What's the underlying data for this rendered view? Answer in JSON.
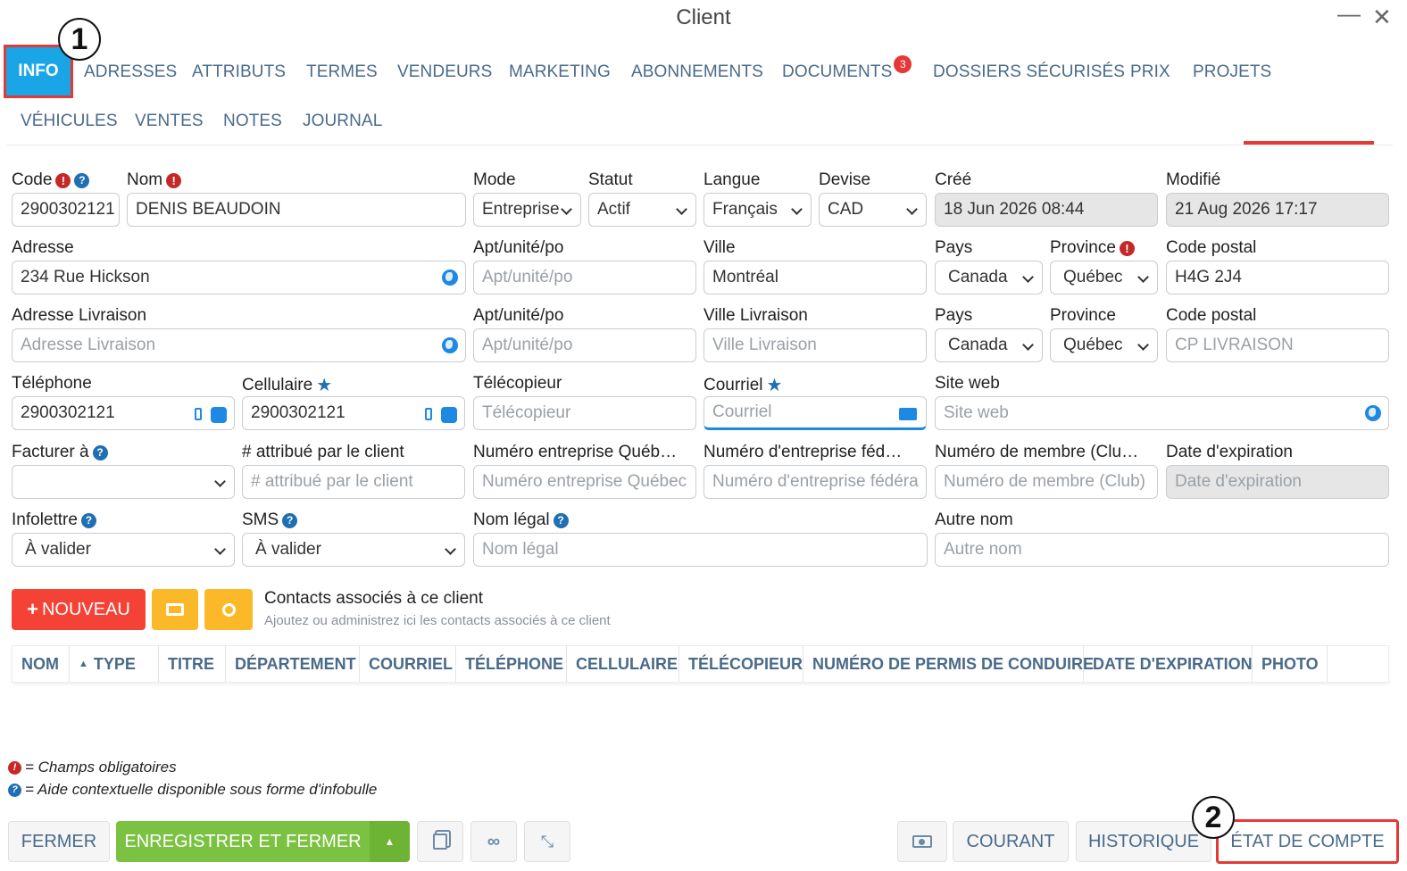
{
  "window": {
    "title": "Client"
  },
  "tabs": {
    "row1": [
      "INFO",
      "ADRESSES",
      "ATTRIBUTS",
      "TERMES",
      "VENDEURS",
      "MARKETING",
      "ABONNEMENTS",
      "DOCUMENTS",
      "DOSSIERS SÉCURISÉS",
      "PRIX",
      "PROJETS"
    ],
    "row2": [
      "VÉHICULES",
      "VENTES",
      "NOTES",
      "JOURNAL"
    ],
    "documents_badge": "3"
  },
  "callouts": {
    "one": "1",
    "two": "2"
  },
  "form": {
    "code": {
      "label": "Code",
      "value": "2900302121"
    },
    "nom": {
      "label": "Nom",
      "value": "DENIS BEAUDOIN"
    },
    "mode": {
      "label": "Mode",
      "value": "Entreprise"
    },
    "statut": {
      "label": "Statut",
      "value": "Actif"
    },
    "langue": {
      "label": "Langue",
      "value": "Français"
    },
    "devise": {
      "label": "Devise",
      "value": "CAD"
    },
    "cree": {
      "label": "Créé",
      "value": "18 Jun 2026 08:44"
    },
    "modifie": {
      "label": "Modifié",
      "value": "21 Aug 2026 17:17"
    },
    "adresse": {
      "label": "Adresse",
      "value": "234 Rue Hickson"
    },
    "apt1": {
      "label": "Apt/unité/po",
      "placeholder": "Apt/unité/po"
    },
    "ville": {
      "label": "Ville",
      "value": "Montréal"
    },
    "pays1": {
      "label": "Pays",
      "value": "Canada"
    },
    "province1": {
      "label": "Province",
      "value": "Québec"
    },
    "cp1": {
      "label": "Code postal",
      "value": "H4G 2J4"
    },
    "adr_liv": {
      "label": "Adresse Livraison",
      "placeholder": "Adresse Livraison"
    },
    "apt2": {
      "label": "Apt/unité/po",
      "placeholder": "Apt/unité/po"
    },
    "ville_liv": {
      "label": "Ville Livraison",
      "placeholder": "Ville Livraison"
    },
    "pays2": {
      "label": "Pays",
      "value": "Canada"
    },
    "province2": {
      "label": "Province",
      "value": "Québec"
    },
    "cp2": {
      "label": "Code postal",
      "placeholder": "CP LIVRAISON"
    },
    "telephone": {
      "label": "Téléphone",
      "value": "2900302121"
    },
    "cellulaire": {
      "label": "Cellulaire",
      "value": "2900302121"
    },
    "telecopieur": {
      "label": "Télécopieur",
      "placeholder": "Télécopieur"
    },
    "courriel": {
      "label": "Courriel",
      "placeholder": "Courriel"
    },
    "siteweb": {
      "label": "Site web",
      "placeholder": "Site web"
    },
    "facturer": {
      "label": "Facturer à",
      "value": ""
    },
    "attribue": {
      "label": "# attribué par le client",
      "placeholder": "# attribué par le client"
    },
    "num_qc": {
      "label": "Numéro entreprise Québ…",
      "placeholder": "Numéro entreprise Québec"
    },
    "num_fed": {
      "label": "Numéro d'entreprise féd…",
      "placeholder": "Numéro d'entreprise fédéra"
    },
    "num_membre": {
      "label": "Numéro de membre (Clu…",
      "placeholder": "Numéro de membre (Club)"
    },
    "date_exp": {
      "label": "Date d'expiration",
      "placeholder": "Date d'expiration"
    },
    "infolettre": {
      "label": "Infolettre",
      "value": "À valider"
    },
    "sms": {
      "label": "SMS",
      "value": "À valider"
    },
    "nom_legal": {
      "label": "Nom légal",
      "placeholder": "Nom légal"
    },
    "autre_nom": {
      "label": "Autre nom",
      "placeholder": "Autre nom"
    }
  },
  "contacts": {
    "new_label": "NOUVEAU",
    "title": "Contacts associés à ce client",
    "subtitle": "Ajoutez ou administrez ici les contacts associés à ce client",
    "columns": [
      "NOM",
      "TYPE",
      "TITRE",
      "DÉPARTEMENT",
      "COURRIEL",
      "TÉLÉPHONE",
      "CELLULAIRE",
      "TÉLÉCOPIEUR",
      "NUMÉRO DE PERMIS DE CONDUIRE",
      "DATE D'EXPIRATION",
      "PHOTO"
    ]
  },
  "legend": {
    "required": "= Champs obligatoires",
    "help": "= Aide contextuelle disponible sous forme d'infobulle"
  },
  "footer": {
    "fermer": "FERMER",
    "enregistrer": "ENREGISTRER ET FERMER",
    "courant": "COURANT",
    "historique": "HISTORIQUE",
    "etat": "ÉTAT DE COMPTE"
  },
  "colors": {
    "accent": "#1aa5e6",
    "danger": "#f44336",
    "success": "#7cc242",
    "warning": "#fbb829"
  }
}
